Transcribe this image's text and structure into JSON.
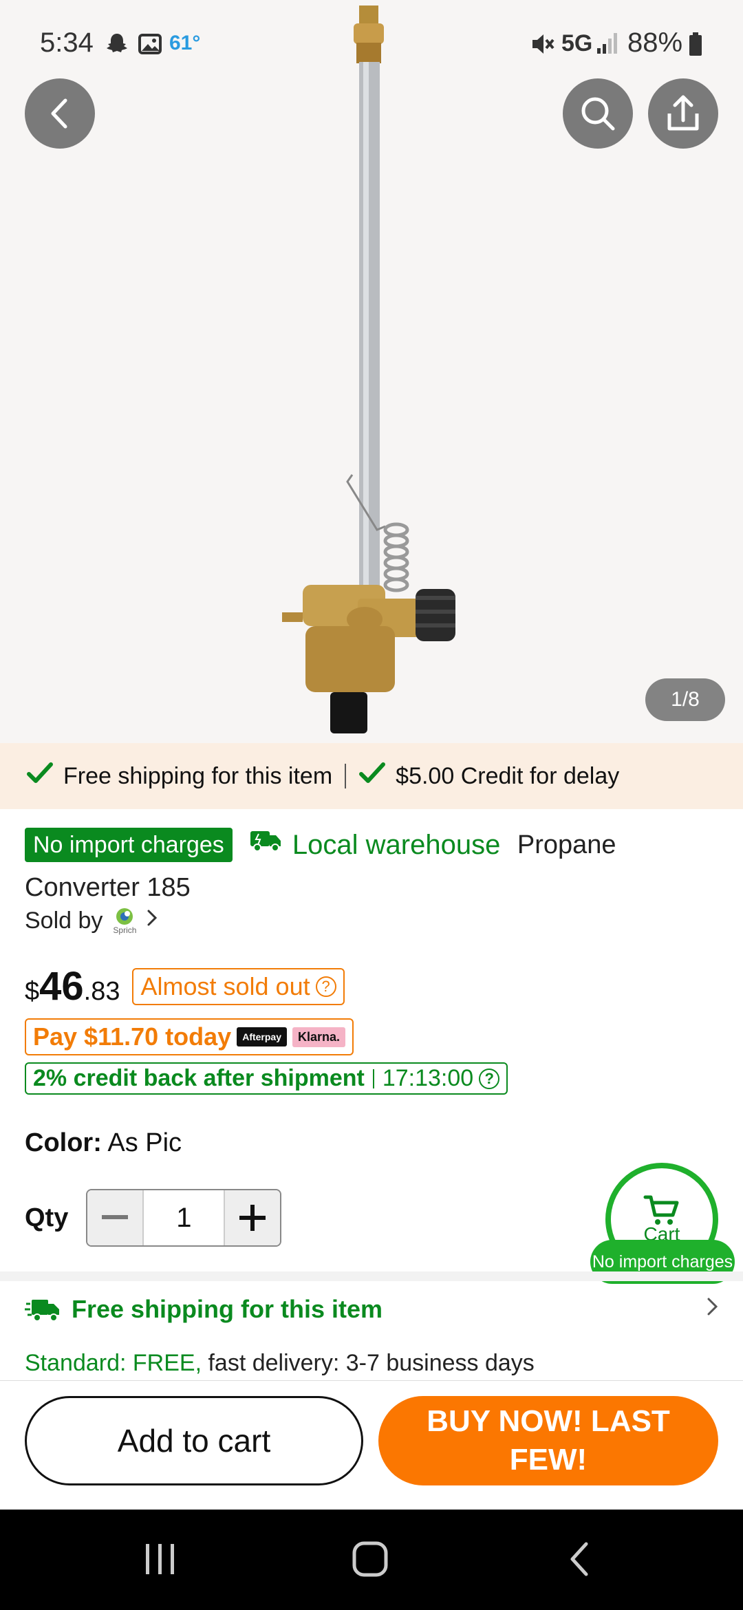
{
  "status_bar": {
    "time": "5:34",
    "temperature": "61°",
    "network": "5G",
    "battery": "88%"
  },
  "hero": {
    "page_counter": "1/8"
  },
  "promo_strip": {
    "left_text": "Free shipping for this item",
    "right_text": "$5.00 Credit for delay"
  },
  "product": {
    "badge": "No import charges",
    "local_warehouse": "Local warehouse",
    "title": "Propane Converter 185",
    "sold_by_label": "Sold by",
    "seller_logo_text": "Sprich"
  },
  "price": {
    "currency": "$",
    "whole": "46",
    "cents": ".83",
    "stock_badge": "Almost sold out"
  },
  "pay_today": {
    "text": "Pay $11.70 today",
    "afterpay_label": "Afterpay",
    "klarna_label": "Klarna."
  },
  "credit_back": {
    "text": "2% credit back after shipment",
    "timer": "17:13:00"
  },
  "color": {
    "label": "Color:",
    "value": "As Pic"
  },
  "quantity": {
    "label": "Qty",
    "value": "1"
  },
  "cart_float": {
    "label": "Cart",
    "pill": "No import charges"
  },
  "shipping": {
    "title": "Free shipping for this item",
    "standard_label": "Standard: FREE,",
    "standard_detail": " fast delivery: 3-7 business days"
  },
  "actions": {
    "add_to_cart": "Add to cart",
    "buy_now": "BUY NOW! LAST FEW!"
  },
  "colors": {
    "brand_green": "#0a8a1f",
    "cart_green": "#1fb02c",
    "orange": "#fb7701",
    "promo_bg": "#fbeee2"
  }
}
